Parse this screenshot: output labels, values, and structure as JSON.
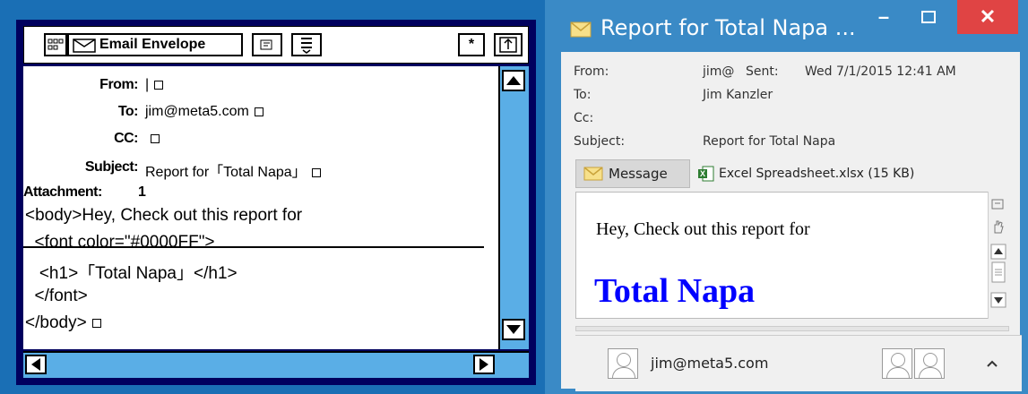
{
  "envelope": {
    "toolbar": {
      "layout_icon": "grid-icon",
      "title_label": "Email Envelope",
      "asterisk_label": "*"
    },
    "header": {
      "from_label": "From:",
      "from_value": "|",
      "to_label": "To:",
      "to_value": "jim@meta5.com",
      "cc_label": "CC:",
      "cc_value": "",
      "subject_label": "Subject:",
      "subject_value": "Report for「Total Napa」",
      "attachment_label": "Attachment:",
      "attachment_value": "1"
    },
    "body_lines": [
      "<body>Hey, Check out this report for",
      "  <font color=\"#0000FF\">",
      "   <h1>「Total Napa」</h1>",
      "  </font>",
      "</body>"
    ]
  },
  "outlook": {
    "window_title": "Report for Total Napa ...",
    "from_label": "From:",
    "from_value": "jim@",
    "sent_label": "Sent:",
    "sent_value": "Wed 7/1/2015 12:41 AM",
    "to_label": "To:",
    "to_value": "Jim Kanzler",
    "cc_label": "Cc:",
    "subject_label": "Subject:",
    "subject_value": "Report for Total Napa",
    "message_tab": "Message",
    "attachment_tab": "Excel Spreadsheet.xlsx (15 KB)",
    "body_text": "Hey, Check out this report for",
    "body_heading": "Total Napa",
    "sender_email": "jim@meta5.com",
    "colors": {
      "title_bar": "#3a8ac6",
      "close": "#e04444",
      "heading": "#0000ff"
    }
  }
}
